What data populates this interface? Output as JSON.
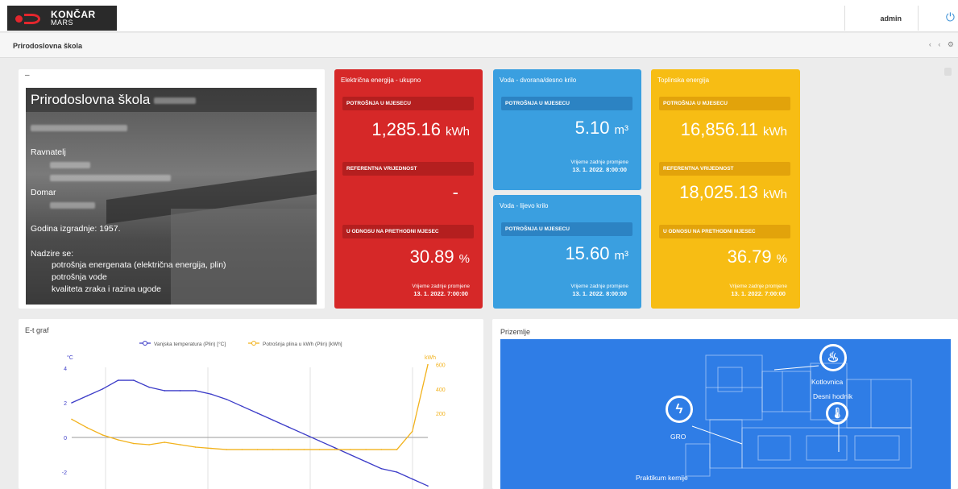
{
  "brand": {
    "name": "KONČAR",
    "sub": "MARS"
  },
  "user": {
    "name": "admin"
  },
  "icons": {
    "power": "power-icon",
    "logo": "koncar-logo-icon"
  },
  "breadcrumb": {
    "title": "Prirodoslovna škola",
    "tools": "‹ ‹ ⚙"
  },
  "info": {
    "dash": "–",
    "school_name": "Prirodoslovna škola",
    "principal_label": "Ravnatelj",
    "caretaker_label": "Domar",
    "built": "Godina izgradnje: 1957.",
    "monitor_label": "Nadzire se:",
    "monitor_items": [
      "potrošnja energenata (električna energija, plin)",
      "potrošnja vode",
      "kvaliteta zraka i razina ugode"
    ]
  },
  "tiles": {
    "electricity": {
      "title": "Električna energija - ukupno",
      "consumption_label": "POTROŠNJA U MJESECU",
      "consumption_value": "1,285.16",
      "consumption_unit": "kWh",
      "reference_label": "REFERENTNA VRIJEDNOST",
      "reference_value": "-",
      "ratio_label": "U ODNOSU NA PRETHODNI MJESEC",
      "ratio_value": "30.89",
      "ratio_unit": "%",
      "changed_label": "Vrijeme zadnje promjene",
      "changed_value": "13. 1. 2022. 7:00:00"
    },
    "water_right": {
      "title": "Voda - dvorana/desno krilo",
      "consumption_label": "POTROŠNJA U MJESECU",
      "consumption_value": "5.10",
      "consumption_unit": "m³",
      "changed_label": "Vrijeme zadnje promjene",
      "changed_value": "13. 1. 2022. 8:00:00"
    },
    "water_left": {
      "title": "Voda - lijevo krilo",
      "consumption_label": "POTROŠNJA U MJESECU",
      "consumption_value": "15.60",
      "consumption_unit": "m³",
      "changed_label": "Vrijeme zadnje promjene",
      "changed_value": "13. 1. 2022. 8:00:00"
    },
    "heating": {
      "title": "Toplinska energija",
      "consumption_label": "POTROŠNJA U MJESECU",
      "consumption_value": "16,856.11",
      "consumption_unit": "kWh",
      "reference_label": "REFERENTNA VRIJEDNOST",
      "reference_value": "18,025.13",
      "reference_unit": "kWh",
      "ratio_label": "U ODNOSU NA PRETHODNI MJESEC",
      "ratio_value": "36.79",
      "ratio_unit": "%",
      "changed_label": "Vrijeme zadnje promjene",
      "changed_value": "13. 1. 2022. 7:00:00"
    }
  },
  "chart_panel": {
    "title": "E-t graf"
  },
  "chart_data": {
    "type": "line",
    "ylabel_left": "°C",
    "ylabel_right": "kWh",
    "yticks_left": [
      4,
      2,
      0,
      -2
    ],
    "yticks_right": [
      600,
      400,
      200
    ],
    "series": [
      {
        "name": "Vanjska temperatura (Plin) [°C]",
        "color": "#3c3cc8",
        "axis": "left",
        "values": [
          2.0,
          2.4,
          2.8,
          3.3,
          3.3,
          2.9,
          2.7,
          2.7,
          2.7,
          2.5,
          2.2,
          1.8,
          1.4,
          1.0,
          0.6,
          0.2,
          -0.2,
          -0.6,
          -1.0,
          -1.4,
          -1.8,
          -2.0,
          -2.4,
          -2.8
        ]
      },
      {
        "name": "Potrošnja plina u kWh (Plin) [kWh]",
        "color": "#f2b21c",
        "axis": "right",
        "values": [
          150,
          80,
          20,
          -20,
          -50,
          -60,
          -40,
          -60,
          -80,
          -90,
          -100,
          -100,
          -100,
          -100,
          -100,
          -100,
          -100,
          -100,
          -100,
          -100,
          -100,
          -100,
          50,
          600
        ]
      }
    ],
    "legend_position": "top"
  },
  "plan_panel": {
    "title": "Prizemlje",
    "labels": {
      "boiler": "Kotlovnica",
      "hall": "Desni hodnik",
      "gro": "GRO",
      "lab": "Praktikum kemije"
    }
  }
}
